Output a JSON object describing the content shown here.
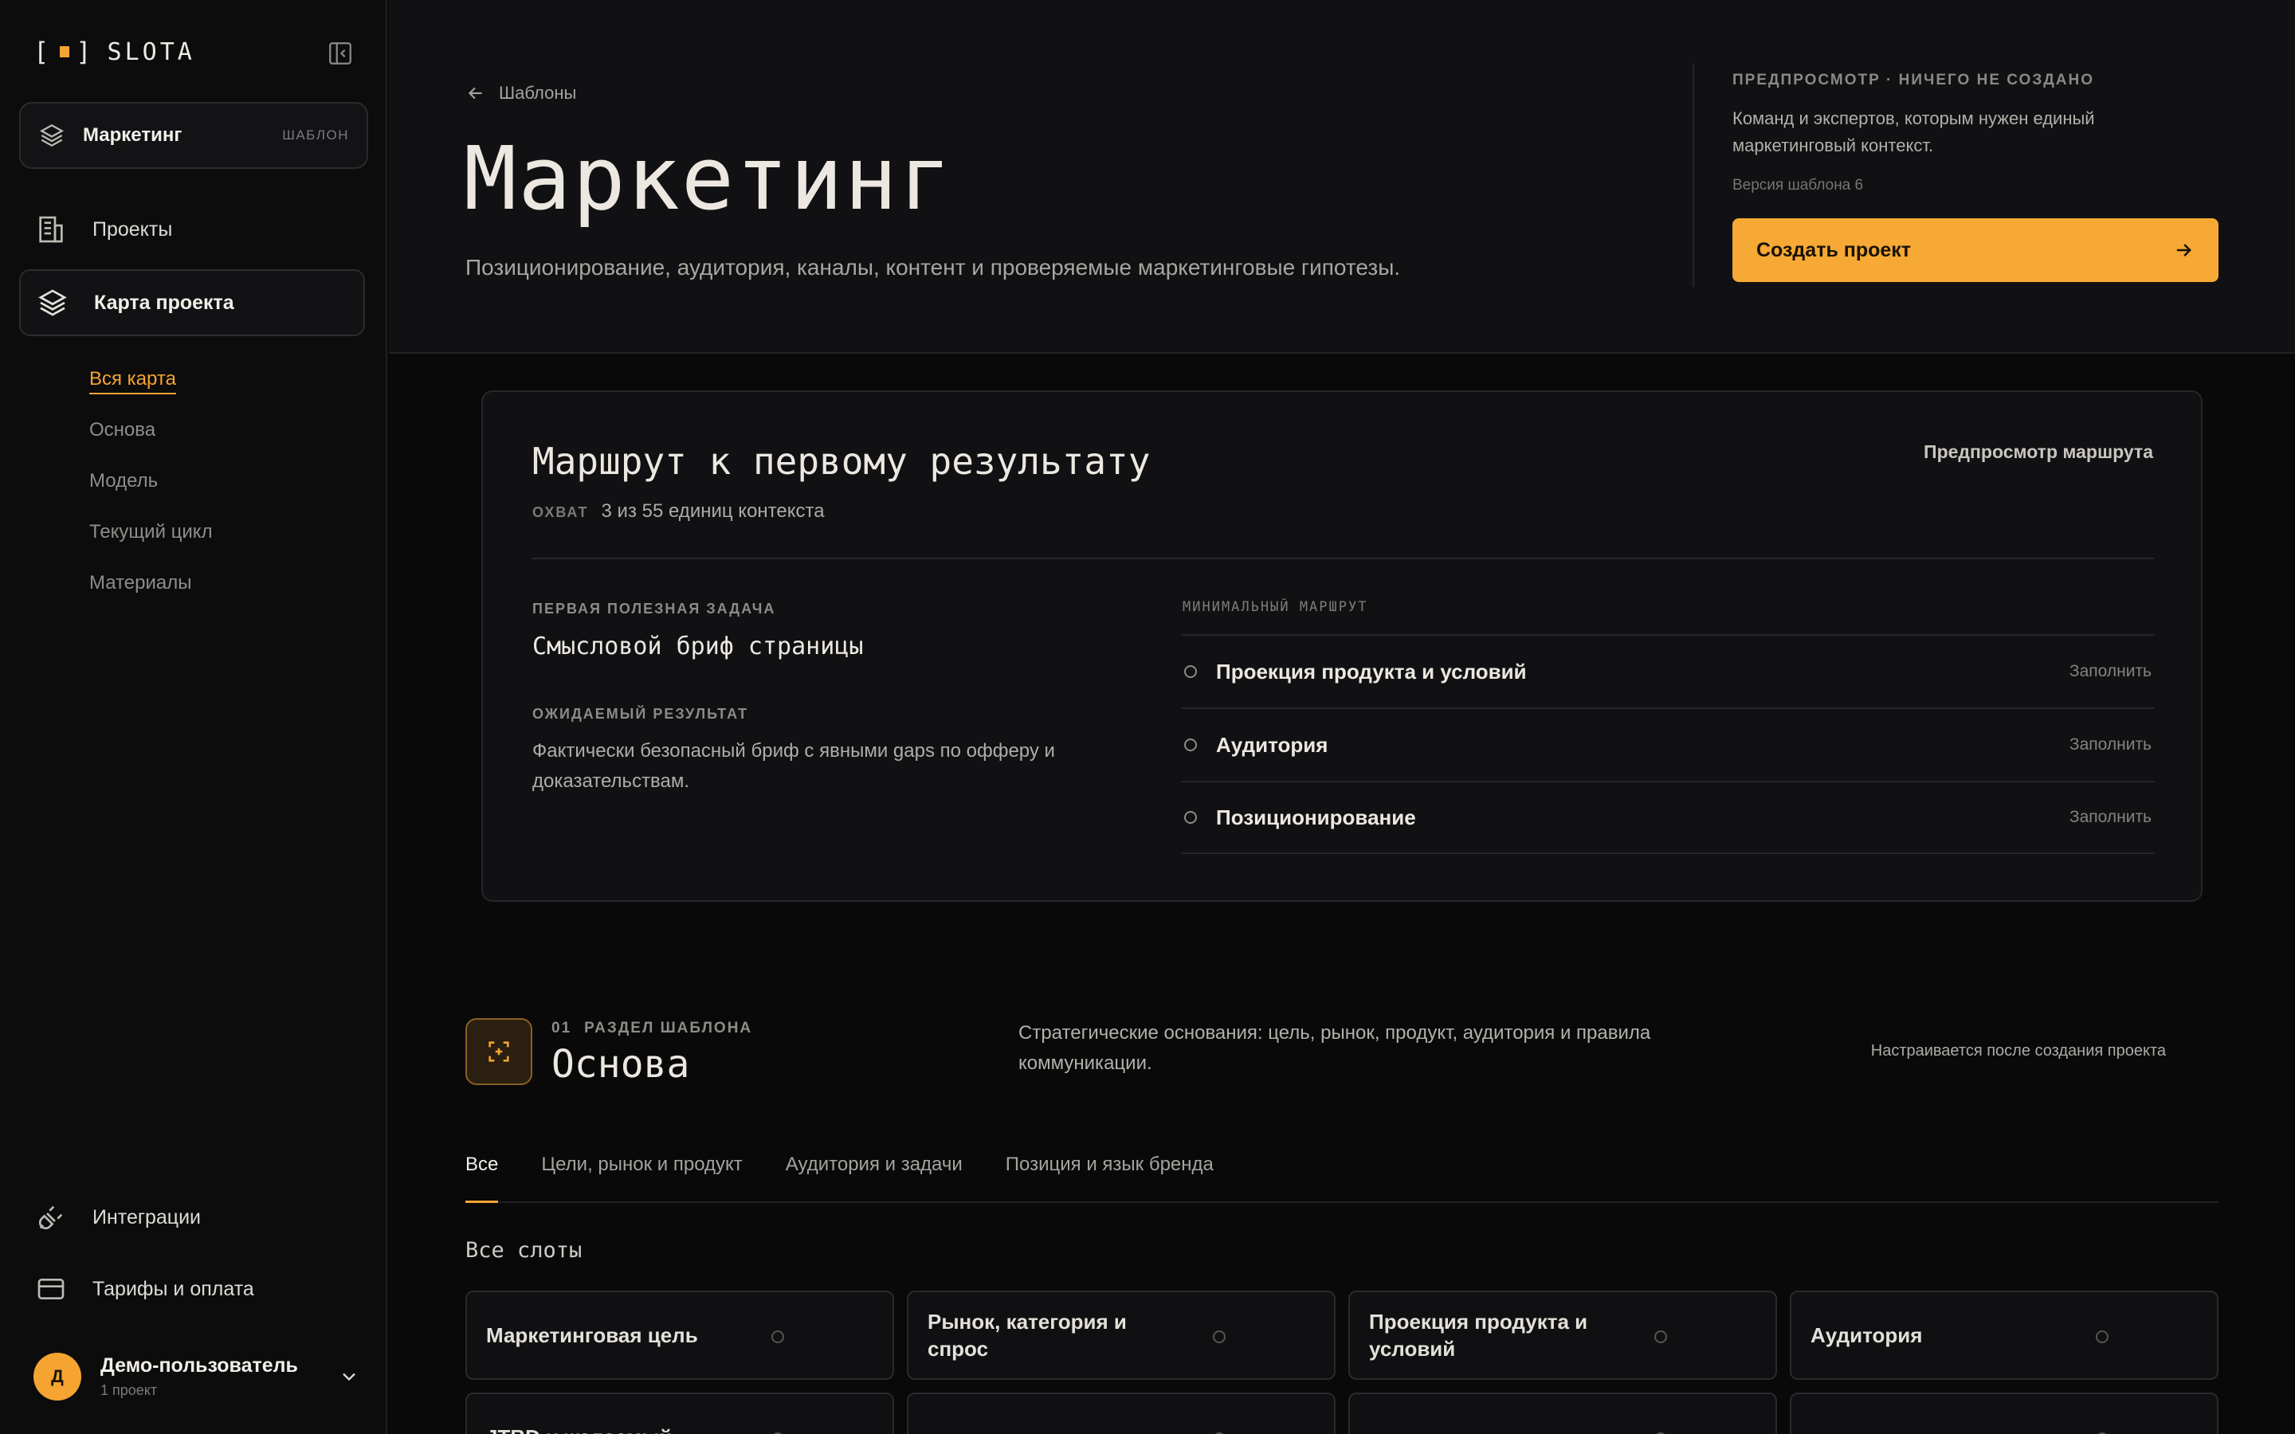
{
  "app": {
    "logo_text": "SLOTA"
  },
  "sidebar": {
    "workspace": {
      "name": "Маркетинг",
      "tag": "ШАБЛОН"
    },
    "nav": [
      {
        "label": "Проекты",
        "icon": "building-icon"
      },
      {
        "label": "Карта проекта",
        "icon": "layers-icon",
        "active": true
      }
    ],
    "sub_nav": [
      {
        "label": "Вся карта",
        "active": true
      },
      {
        "label": "Основа"
      },
      {
        "label": "Модель"
      },
      {
        "label": "Текущий цикл"
      },
      {
        "label": "Материалы"
      }
    ],
    "bottom_nav": [
      {
        "label": "Интеграции",
        "icon": "plug-icon"
      },
      {
        "label": "Тарифы и оплата",
        "icon": "credit-card-icon"
      }
    ],
    "user": {
      "initial": "Д",
      "name": "Демо-пользователь",
      "sub": "1 проект"
    }
  },
  "header": {
    "back_label": "Шаблоны",
    "title": "Маркетинг",
    "subtitle": "Позиционирование, аудитория, каналы, контент и проверяемые маркетинговые гипотезы.",
    "preview_label": "ПРЕДПРОСМОТР · НИЧЕГО НЕ СОЗДАНО",
    "preview_desc": "Команд и экспертов, которым нужен единый маркетинговый контекст.",
    "version": "Версия шаблона 6",
    "cta_label": "Создать проект"
  },
  "route": {
    "title": "Маршрут к первому результату",
    "preview_link": "Предпросмотр маршрута",
    "coverage_key": "ОХВАТ",
    "coverage_value": "3 из 55 единиц контекста",
    "first_task_label": "ПЕРВАЯ ПОЛЕЗНАЯ ЗАДАЧА",
    "first_task": "Смысловой бриф страницы",
    "expected_label": "ОЖИДАЕМЫЙ РЕЗУЛЬТАТ",
    "expected": "Фактически безопасный бриф с явными gaps по офферу и доказательствам.",
    "min_route_label": "МИНИМАЛЬНЫЙ МАРШРУТ",
    "steps": [
      {
        "name": "Проекция продукта и условий",
        "action": "Заполнить"
      },
      {
        "name": "Аудитория",
        "action": "Заполнить"
      },
      {
        "name": "Позиционирование",
        "action": "Заполнить"
      }
    ]
  },
  "section": {
    "number": "01",
    "kind": "РАЗДЕЛ ШАБЛОНА",
    "title": "Основа",
    "desc": "Стратегические основания: цель, рынок, продукт, аудитория и правила коммуникации.",
    "note": "Настраивается после создания проекта",
    "tabs": [
      {
        "label": "Все",
        "active": true
      },
      {
        "label": "Цели, рынок и продукт"
      },
      {
        "label": "Аудитория и задачи"
      },
      {
        "label": "Позиция и язык бренда"
      }
    ],
    "all_slots_label": "Все слоты",
    "slots": [
      "Маркетинговая цель",
      "Рынок, категория и спрос",
      "Проекция продукта и условий",
      "Аудитория",
      "JTBD и желаемый",
      "",
      "",
      ""
    ]
  },
  "colors": {
    "accent": "#f5a431",
    "background": "#09090a",
    "sidebar": "#0c0c0d"
  }
}
